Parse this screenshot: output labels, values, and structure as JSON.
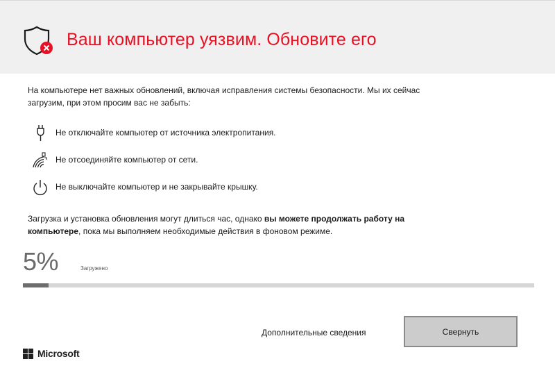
{
  "header": {
    "title": "Ваш компьютер уязвим. Обновите его",
    "icon": "shield-error-icon",
    "accent_color": "#e81123",
    "background": "#f0f0f0"
  },
  "intro": {
    "line1": "На компьютере нет важных обновлений, включая исправления системы безопасности. Мы их сейчас",
    "line2": "загрузим, при этом просим вас не забыть:"
  },
  "requirements": [
    {
      "icon": "power-plug-icon",
      "text": "Не отключайте компьютер от источника электропитания."
    },
    {
      "icon": "network-icon",
      "text": "Не отсоединяйте компьютер от сети."
    },
    {
      "icon": "power-button-icon",
      "text": "Не выключайте компьютер и не закрывайте крышку."
    }
  ],
  "note": {
    "part1": "Загрузка и установка обновления могут длиться час, однако ",
    "bold1": "вы можете продолжать работу на",
    "bold2": "компьютере",
    "part2": ", пока мы выполняем необходимые действия в фоновом режиме."
  },
  "progress": {
    "percent_text": "5%",
    "label": "Загружено",
    "value": 0.05
  },
  "actions": {
    "more_info": "Дополнительные сведения",
    "collapse": "Свернуть"
  },
  "brand": {
    "name": "Microsoft",
    "icon": "microsoft-logo-icon"
  }
}
